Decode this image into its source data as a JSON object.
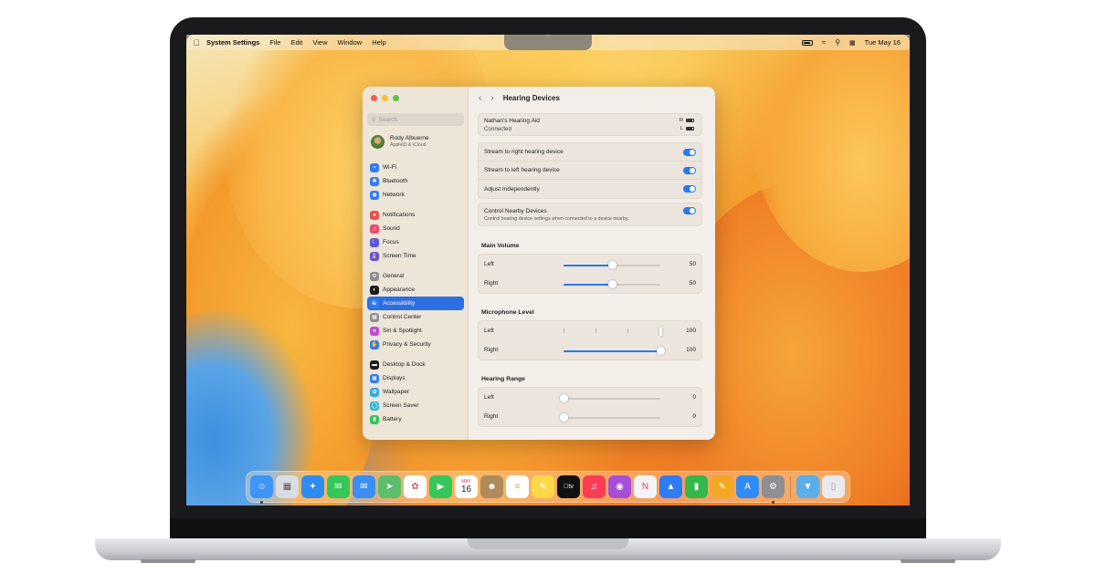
{
  "menubar": {
    "app_name": "System Settings",
    "menus": [
      "File",
      "Edit",
      "View",
      "Window",
      "Help"
    ],
    "datetime": "Tue May 16"
  },
  "sidebar": {
    "search_placeholder": "Search",
    "user": {
      "name": "Rody Albuerne",
      "subtitle": "AppleID & iCloud"
    },
    "groups": [
      [
        {
          "label": "Wi-Fi",
          "icon": "wifi-icon",
          "color": "#2f7cf6"
        },
        {
          "label": "Bluetooth",
          "icon": "bluetooth-icon",
          "color": "#2f7cf6"
        },
        {
          "label": "Network",
          "icon": "globe-icon",
          "color": "#2f7cf6"
        }
      ],
      [
        {
          "label": "Notifications",
          "icon": "bell-icon",
          "color": "#ef4e44"
        },
        {
          "label": "Sound",
          "icon": "speaker-icon",
          "color": "#ee4a6a"
        },
        {
          "label": "Focus",
          "icon": "moon-icon",
          "color": "#5b57d6"
        },
        {
          "label": "Screen Time",
          "icon": "hourglass-icon",
          "color": "#6a4fd8"
        }
      ],
      [
        {
          "label": "General",
          "icon": "gear-icon",
          "color": "#8e8e93"
        },
        {
          "label": "Appearance",
          "icon": "appearance-icon",
          "color": "#1c1c1e"
        },
        {
          "label": "Accessibility",
          "icon": "accessibility-icon",
          "color": "#2f7cf6",
          "selected": true
        },
        {
          "label": "Control Center",
          "icon": "control-center-icon",
          "color": "#8e8e93"
        },
        {
          "label": "Siri & Spotlight",
          "icon": "siri-icon",
          "color": "#c34bd4"
        },
        {
          "label": "Privacy & Security",
          "icon": "hand-icon",
          "color": "#2f7cf6"
        }
      ],
      [
        {
          "label": "Desktop & Dock",
          "icon": "dock-icon",
          "color": "#1c1c1e"
        },
        {
          "label": "Displays",
          "icon": "display-icon",
          "color": "#2f7cf6"
        },
        {
          "label": "Wallpaper",
          "icon": "wallpaper-icon",
          "color": "#35aadc"
        },
        {
          "label": "Screen Saver",
          "icon": "screensaver-icon",
          "color": "#35b8d8"
        },
        {
          "label": "Battery",
          "icon": "battery-icon",
          "color": "#34c759"
        }
      ]
    ]
  },
  "main": {
    "title": "Hearing Devices",
    "device": {
      "name": "Nathan's Hearing Aid",
      "status": "Connected",
      "right_label": "R",
      "left_label": "L"
    },
    "toggles": [
      {
        "label": "Stream to right hearing device",
        "on": true
      },
      {
        "label": "Stream to left hearing device",
        "on": true
      },
      {
        "label": "Adjust Independently",
        "on": true
      }
    ],
    "nearby": {
      "label": "Control Nearby Devices",
      "description": "Control hearing device settings when connected to a device nearby.",
      "on": true
    },
    "main_volume": {
      "heading": "Main Volume",
      "left": {
        "label": "Left",
        "value": "50",
        "fraction": 0.5
      },
      "right": {
        "label": "Right",
        "value": "50",
        "fraction": 0.5
      }
    },
    "microphone_level": {
      "heading": "Microphone Level",
      "left": {
        "label": "Left",
        "value": "100",
        "fraction": 1.0
      },
      "right": {
        "label": "Right",
        "value": "100",
        "fraction": 1.0
      }
    },
    "hearing_range": {
      "heading": "Hearing Range",
      "left": {
        "label": "Left",
        "value": "0",
        "fraction": 0.0
      },
      "right": {
        "label": "Right",
        "value": "0",
        "fraction": 0.0
      }
    }
  },
  "dock": {
    "calendar_month": "MAY",
    "calendar_day": "16",
    "tv_label": "tv",
    "apps": [
      {
        "name": "finder",
        "icon": "finder-icon",
        "color": "#3f95f5",
        "running": true
      },
      {
        "name": "launchpad",
        "icon": "launchpad-icon",
        "color": "#d9dde3"
      },
      {
        "name": "safari",
        "icon": "safari-icon",
        "color": "#2f8bf0"
      },
      {
        "name": "messages",
        "icon": "messages-icon",
        "color": "#35c759"
      },
      {
        "name": "mail",
        "icon": "mail-icon",
        "color": "#3a8ef6"
      },
      {
        "name": "maps",
        "icon": "maps-icon",
        "color": "#5bbf6a"
      },
      {
        "name": "photos",
        "icon": "photos-icon",
        "color": "#ffffff"
      },
      {
        "name": "facetime",
        "icon": "facetime-icon",
        "color": "#34c759"
      },
      {
        "name": "calendar",
        "icon": "calendar-icon",
        "color": "#ffffff"
      },
      {
        "name": "contacts",
        "icon": "contacts-icon",
        "color": "#b08a5a"
      },
      {
        "name": "reminders",
        "icon": "reminders-icon",
        "color": "#ffffff"
      },
      {
        "name": "notes",
        "icon": "notes-icon",
        "color": "#ffd84a"
      },
      {
        "name": "apple-tv",
        "icon": "tv-icon",
        "color": "#111111"
      },
      {
        "name": "music",
        "icon": "music-icon",
        "color": "#fa3c55"
      },
      {
        "name": "podcasts",
        "icon": "podcasts-icon",
        "color": "#a74ed8"
      },
      {
        "name": "news",
        "icon": "news-icon",
        "color": "#f4f4f6"
      },
      {
        "name": "keynote",
        "icon": "keynote-icon",
        "color": "#2f7cf6"
      },
      {
        "name": "numbers",
        "icon": "numbers-icon",
        "color": "#35b84a"
      },
      {
        "name": "pages",
        "icon": "pages-icon",
        "color": "#f5a623"
      },
      {
        "name": "app-store",
        "icon": "app-store-icon",
        "color": "#2f8cf6"
      },
      {
        "name": "system-settings",
        "icon": "system-settings-icon",
        "color": "#8e8e93",
        "running": true
      },
      {
        "name": "downloads-folder",
        "icon": "folder-icon",
        "color": "#5aaee9"
      },
      {
        "name": "trash",
        "icon": "trash-icon",
        "color": "#e8eaee"
      }
    ]
  },
  "colors": {
    "accent": "#2d78e8",
    "selection": "#2d6fe0"
  }
}
